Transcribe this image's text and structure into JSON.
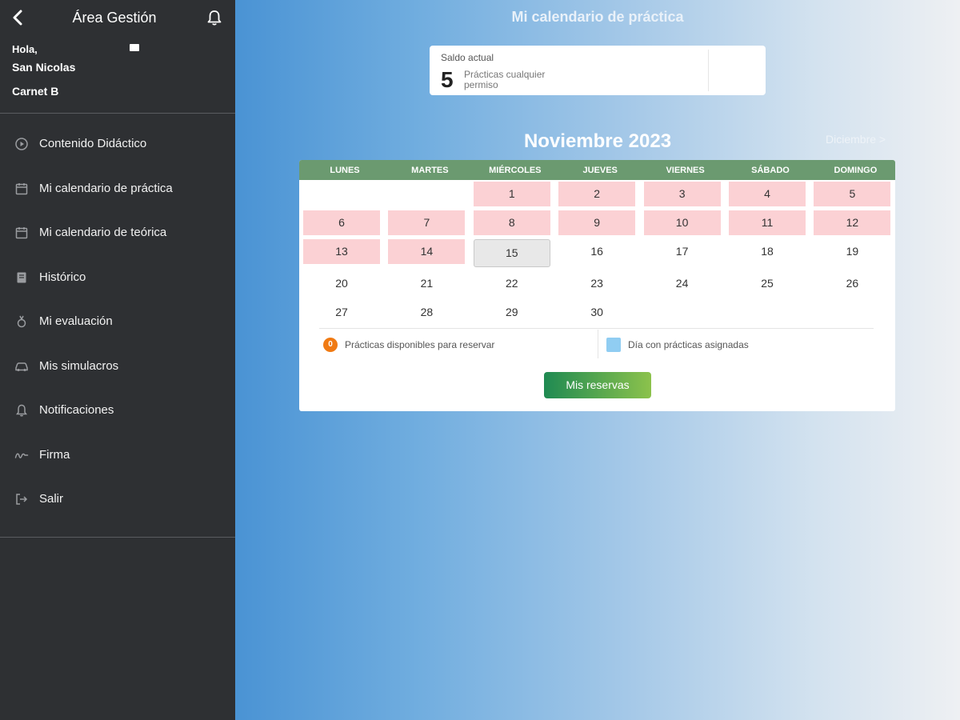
{
  "sidebar": {
    "title": "Área Gestión",
    "greeting": "Hola,",
    "user_name": "San Nicolas",
    "license": "Carnet B",
    "items": [
      {
        "label": "Contenido Didáctico",
        "icon": "play-circle-icon"
      },
      {
        "label": "Mi calendario de práctica",
        "icon": "calendar-icon"
      },
      {
        "label": "Mi calendario de teórica",
        "icon": "calendar-icon"
      },
      {
        "label": "Histórico",
        "icon": "book-icon"
      },
      {
        "label": "Mi evaluación",
        "icon": "medal-icon"
      },
      {
        "label": "Mis simulacros",
        "icon": "car-icon"
      },
      {
        "label": "Notificaciones",
        "icon": "bell-icon"
      },
      {
        "label": "Firma",
        "icon": "signature-icon"
      },
      {
        "label": "Salir",
        "icon": "logout-icon"
      }
    ]
  },
  "main": {
    "title": "Mi calendario de práctica",
    "balance": {
      "label": "Saldo actual",
      "value": "5",
      "description": "Prácticas cualquier permiso"
    },
    "calendar": {
      "month": "Noviembre 2023",
      "next_month": "Diciembre >",
      "weekdays": [
        "LUNES",
        "MARTES",
        "MIÉRCOLES",
        "JUEVES",
        "VIERNES",
        "SÁBADO",
        "DOMINGO"
      ],
      "first_weekday_index": 2,
      "days_in_month": 30,
      "today": 15,
      "available_days": [
        1,
        2,
        3,
        4,
        5,
        6,
        7,
        8,
        9,
        10,
        11,
        12,
        13,
        14
      ]
    },
    "legend": {
      "available_count": "0",
      "available_label": "Prácticas disponibles para reservar",
      "assigned_label": "Día con prácticas asignadas"
    },
    "reserve_button": "Mis reservas"
  },
  "colors": {
    "sidebar_bg": "#2e3033",
    "header_green": "#6b9a70",
    "available_pink": "#fbd1d4",
    "legend_orange": "#f07a13",
    "legend_blue": "#90cdf2"
  }
}
